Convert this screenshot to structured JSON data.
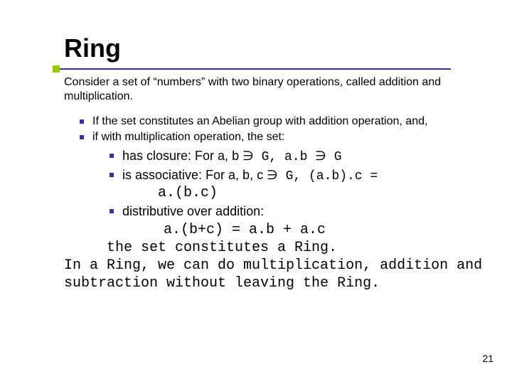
{
  "title": "Ring",
  "intro": "Consider a set of “numbers” with two binary operations, called addition and multiplication.",
  "list1": {
    "item1": "If the set constitutes an Abelian group with addition operation, and,",
    "item2": "if with multiplication operation, the set:"
  },
  "list2": {
    "closure_pre": "has closure: For a, b",
    "closure_mid": "G, a.b",
    "closure_end": "G",
    "assoc_pre": "is associative: For a, b, c",
    "assoc_mid": "G, (a.b).c =",
    "assoc_cont": "a.(b.c)",
    "dist_label": "distributive over addition:"
  },
  "equation": "a.(b+c) = a.b + a.c",
  "conclusion_line1": "the set constitutes a Ring.",
  "conclusion_rest": "In a Ring, we can do multiplication, addition and subtraction without leaving the Ring.",
  "in_symbol": "∈",
  "page_number": "21"
}
